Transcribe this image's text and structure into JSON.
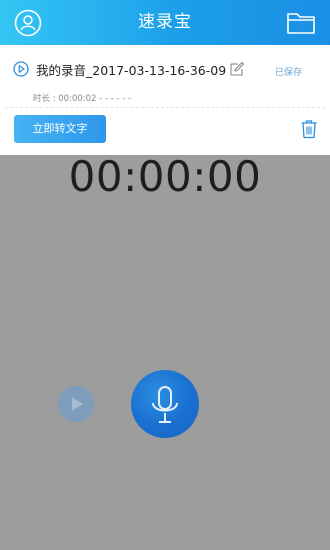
{
  "header": {
    "title": "速录宝",
    "left_icon": "user-icon",
    "right_icon": "folder-icon"
  },
  "recording": {
    "filename": "我的录音_2017-03-13-16-36-09",
    "status": "已保存",
    "duration_text": "时长 : 00:00:02  - - - - - -",
    "convert_label": "立即转文字"
  },
  "player": {
    "timer": "00:00:00"
  },
  "colors": {
    "accent": "#1b9ee9",
    "overlay": "#9d9d9d",
    "mic": "#1a6fd0"
  }
}
